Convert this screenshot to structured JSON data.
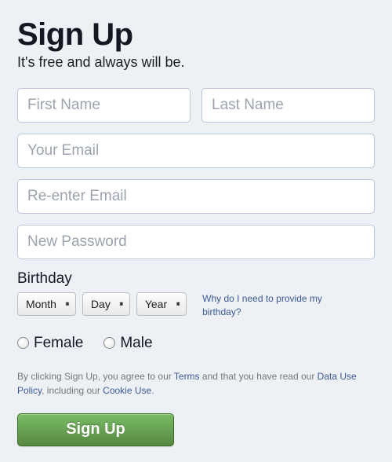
{
  "header": {
    "title": "Sign Up",
    "subtitle": "It's free and always will be."
  },
  "fields": {
    "first_name_placeholder": "First Name",
    "last_name_placeholder": "Last Name",
    "email_placeholder": "Your Email",
    "reenter_email_placeholder": "Re-enter Email",
    "password_placeholder": "New Password"
  },
  "birthday": {
    "label": "Birthday",
    "month": "Month",
    "day": "Day",
    "year": "Year",
    "why_link": "Why do I need to provide my birthday?"
  },
  "gender": {
    "female": "Female",
    "male": "Male"
  },
  "terms": {
    "prefix": "By clicking Sign Up, you agree to our ",
    "terms_link": "Terms",
    "middle": " and that you have read our ",
    "data_policy_link": "Data Use Policy",
    "middle2": ", including our ",
    "cookie_link": "Cookie Use",
    "suffix": "."
  },
  "button": {
    "signup": "Sign Up"
  }
}
